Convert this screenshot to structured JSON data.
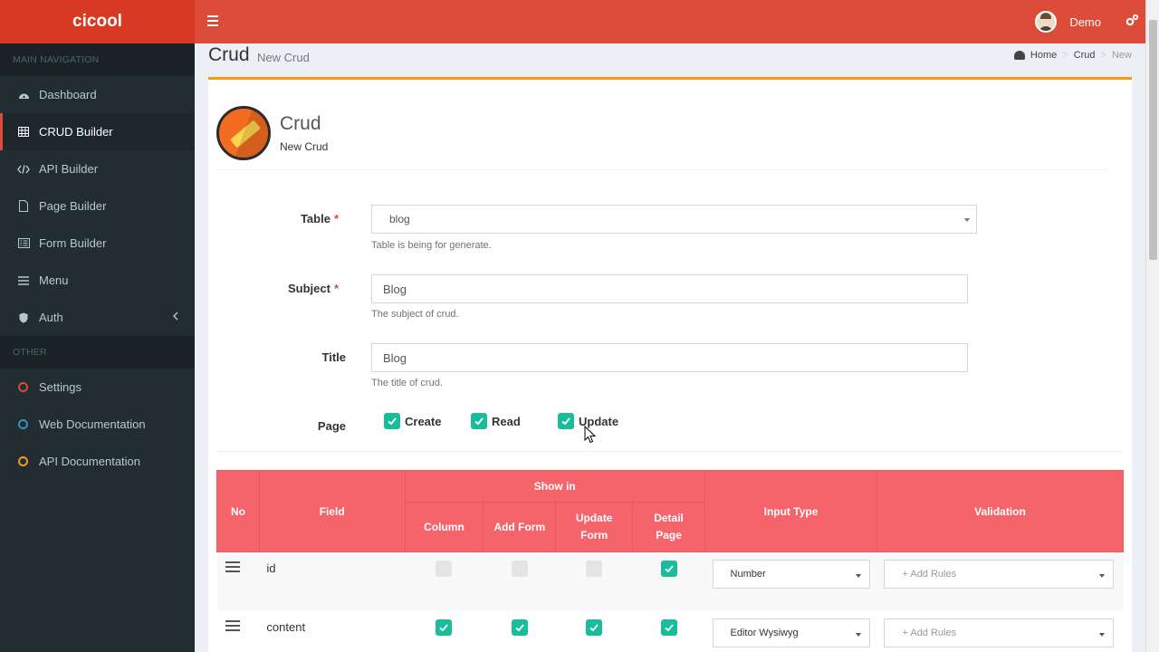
{
  "app": {
    "logo": "cicool"
  },
  "topbar": {
    "user_name": "Demo"
  },
  "sidebar": {
    "main_header": "MAIN NAVIGATION",
    "other_header": "OTHER",
    "items": [
      {
        "label": "Dashboard"
      },
      {
        "label": "CRUD Builder"
      },
      {
        "label": "API Builder"
      },
      {
        "label": "Page Builder"
      },
      {
        "label": "Form Builder"
      },
      {
        "label": "Menu"
      },
      {
        "label": "Auth"
      }
    ],
    "other_items": [
      {
        "label": "Settings",
        "color": "#dd4b39"
      },
      {
        "label": "Web Documentation",
        "color": "#3c8dbc"
      },
      {
        "label": "API Documentation",
        "color": "#f39c12"
      }
    ]
  },
  "page": {
    "title": "Crud",
    "subtitle": "New Crud",
    "breadcrumb": [
      "Home",
      "Crud",
      "New"
    ]
  },
  "box": {
    "title": "Crud",
    "subtitle": "New Crud"
  },
  "form": {
    "table_label": "Table",
    "table_value": "blog",
    "table_help": "Table is being for generate.",
    "subject_label": "Subject",
    "subject_value": "Blog",
    "subject_help": "The subject of crud.",
    "title_label": "Title",
    "title_value": "Blog",
    "title_help": "The title of crud.",
    "page_label": "Page",
    "page_options": [
      "Create",
      "Read",
      "Update"
    ],
    "required_mark": "*"
  },
  "table": {
    "headers": {
      "no": "No",
      "field": "Field",
      "show_in": "Show in",
      "column": "Column",
      "add_form": "Add Form",
      "update_form": "Update Form",
      "detail_page": "Detail Page",
      "input_type": "Input Type",
      "validation": "Validation"
    },
    "rows": [
      {
        "field": "id",
        "column": false,
        "add_form": false,
        "update_form": false,
        "detail_page": true,
        "input_type": "Number",
        "validation": "+ Add Rules"
      },
      {
        "field": "content",
        "column": true,
        "add_form": true,
        "update_form": true,
        "detail_page": true,
        "input_type": "Editor Wysiwyg",
        "validation": "+ Add Rules"
      }
    ]
  },
  "colors": {
    "brand": "#dd4b39",
    "table_header": "#f5646a",
    "check": "#1abc9c",
    "box_top": "#f39c12"
  }
}
